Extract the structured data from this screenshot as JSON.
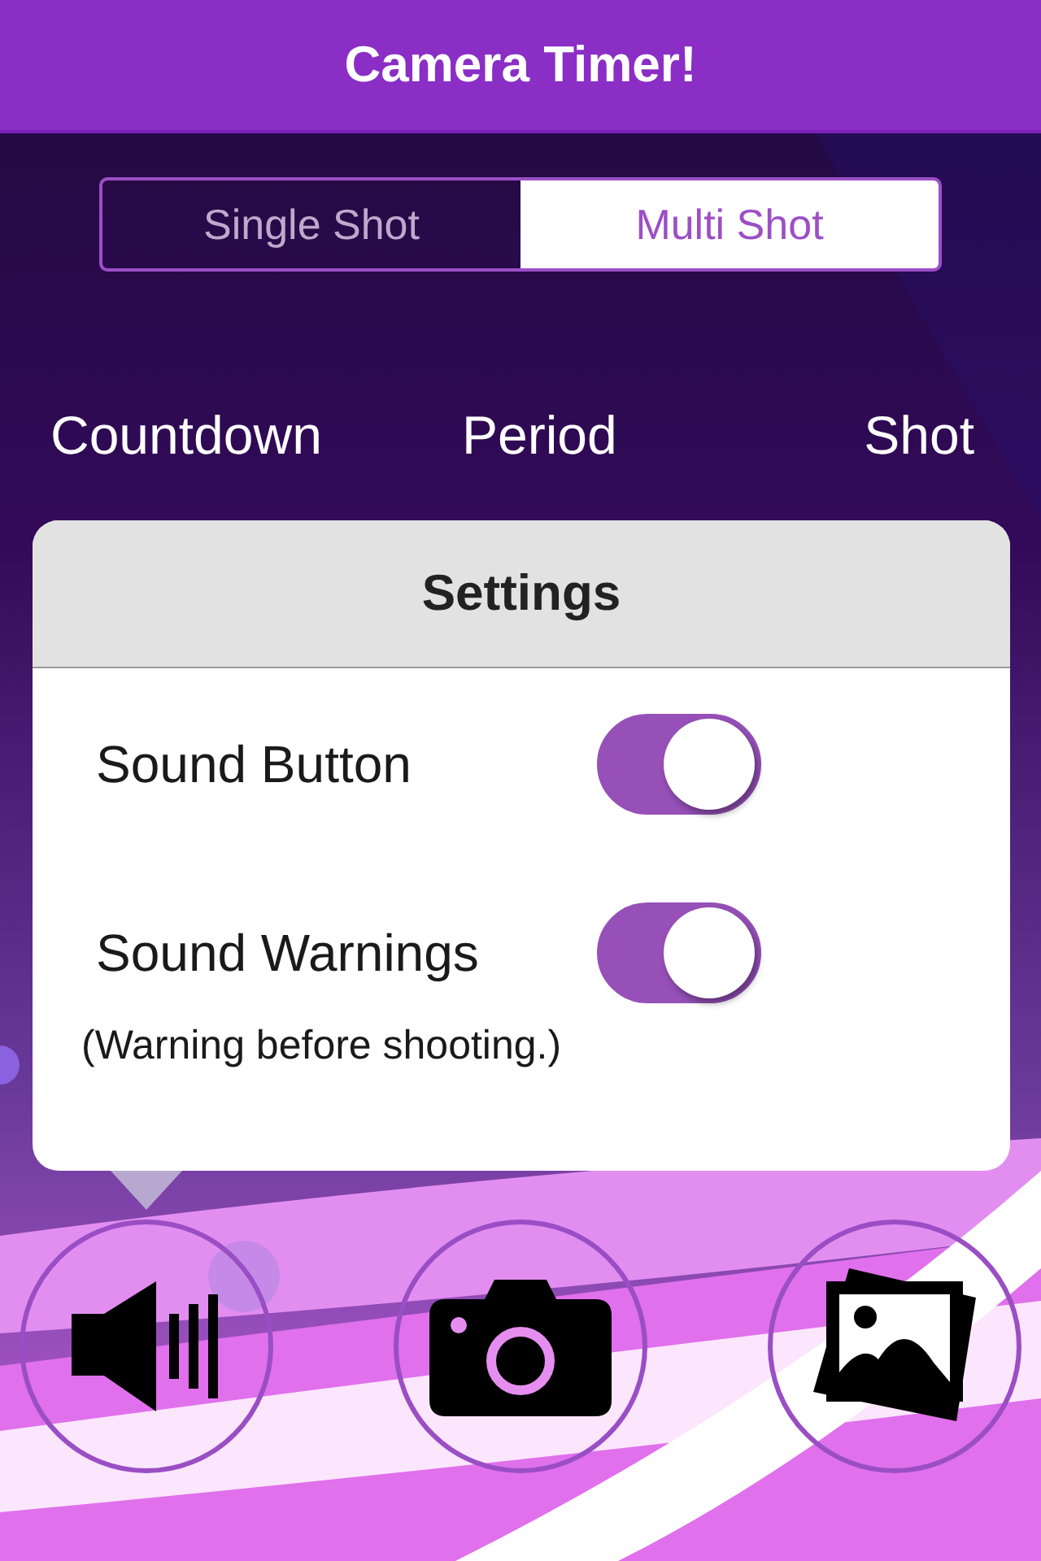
{
  "header": {
    "title": "Camera Timer!"
  },
  "mode_tabs": [
    {
      "label": "Single Shot",
      "selected": false
    },
    {
      "label": "Multi Shot",
      "selected": true
    }
  ],
  "columns": [
    "Countdown",
    "Period",
    "Shot"
  ],
  "settings_popover": {
    "title": "Settings",
    "items": [
      {
        "label": "Sound Button",
        "on": true
      },
      {
        "label": "Sound Warnings",
        "on": true,
        "note": "(Warning before shooting.)"
      }
    ]
  },
  "toolbar": [
    {
      "kind": "sound"
    },
    {
      "kind": "camera"
    },
    {
      "kind": "gallery"
    }
  ]
}
